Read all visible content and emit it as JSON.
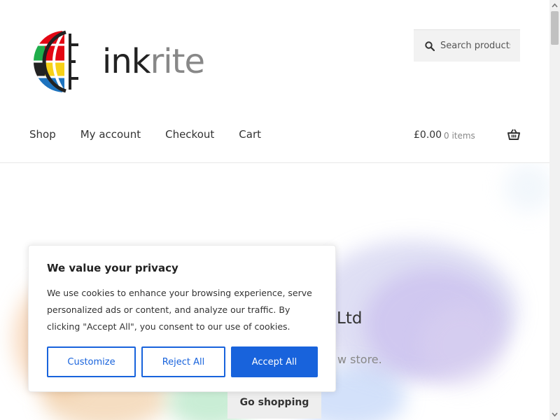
{
  "brand": {
    "name_part1": "ink",
    "name_part2": "rite",
    "colors": [
      "#e30613",
      "#f7d117",
      "#1fae4b",
      "#1e73be",
      "#222222"
    ]
  },
  "search": {
    "placeholder": "Search products"
  },
  "nav": {
    "items": [
      {
        "label": "Shop"
      },
      {
        "label": "My account"
      },
      {
        "label": "Checkout"
      },
      {
        "label": "Cart"
      }
    ]
  },
  "cart": {
    "total": "£0.00",
    "count": "0 items"
  },
  "hero": {
    "title": "Ltd",
    "subtitle": "w store.",
    "button": "Go shopping"
  },
  "cookie": {
    "title": "We value your privacy",
    "text": "We use cookies to enhance your browsing experience, serve personalized ads or content, and analyze our traffic. By clicking \"Accept All\", you consent to our use of cookies.",
    "customize": "Customize",
    "reject": "Reject All",
    "accept": "Accept All",
    "accent": "#1863dc"
  }
}
